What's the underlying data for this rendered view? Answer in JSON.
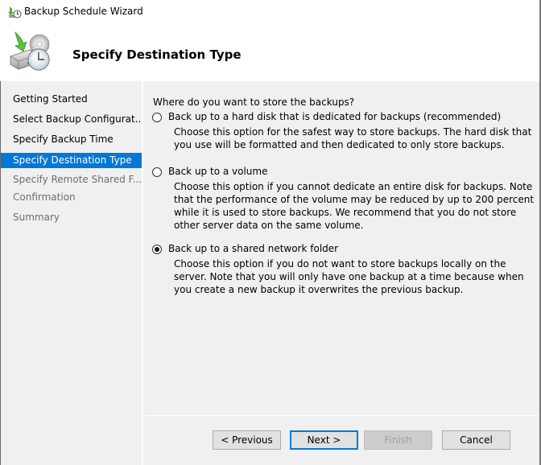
{
  "window": {
    "title": "Backup Schedule Wizard",
    "icon": "backup-schedule-icon"
  },
  "header": {
    "title": "Specify Destination Type",
    "icon": "backup-disk-clock-icon"
  },
  "sidebar": {
    "steps": [
      {
        "label": "Getting Started",
        "state": "done"
      },
      {
        "label": "Select Backup Configurat...",
        "state": "done"
      },
      {
        "label": "Specify Backup Time",
        "state": "done"
      },
      {
        "label": "Specify Destination Type",
        "state": "active"
      },
      {
        "label": "Specify Remote Shared F...",
        "state": "future"
      },
      {
        "label": "Confirmation",
        "state": "future"
      },
      {
        "label": "Summary",
        "state": "future"
      }
    ]
  },
  "main": {
    "question": "Where do you want to store the backups?",
    "options": [
      {
        "label": "Back up to a hard disk that is dedicated for backups (recommended)",
        "description": "Choose this option for the safest way to store backups. The hard disk that you use will be formatted and then dedicated to only store backups.",
        "selected": false
      },
      {
        "label": "Back up to a volume",
        "description": "Choose this option if you cannot dedicate an entire disk for backups. Note that the performance of the volume may be reduced by up to 200 percent while it is used to store backups. We recommend that you do not store other server data on the same volume.",
        "selected": false
      },
      {
        "label": "Back up to a shared network folder",
        "description": "Choose this option if you do not want to store backups locally on the server. Note that you will only have one backup at a time because when you create a new backup it overwrites the previous backup.",
        "selected": true
      }
    ]
  },
  "footer": {
    "previous_label": "< Previous",
    "next_label": "Next >",
    "finish_label": "Finish",
    "cancel_label": "Cancel",
    "finish_enabled": false
  },
  "colors": {
    "accent": "#0078d7",
    "panel_bg": "#f0f0f0",
    "disabled_text": "#a0a0a0"
  }
}
